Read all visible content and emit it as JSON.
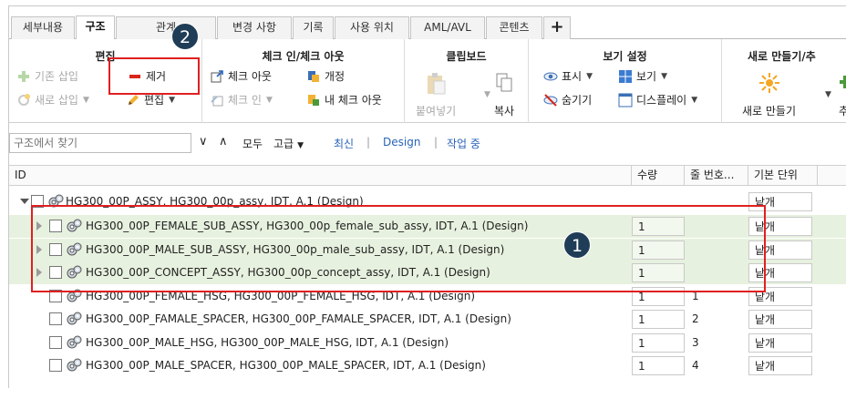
{
  "tabs": [
    {
      "label": "세부내용",
      "active": false
    },
    {
      "label": "구조",
      "active": true
    },
    {
      "label": "관계",
      "active": false
    },
    {
      "label": "변경 사항",
      "active": false
    },
    {
      "label": "기록",
      "active": false
    },
    {
      "label": "사용 위치",
      "active": false
    },
    {
      "label": "AML/AVL",
      "active": false
    },
    {
      "label": "콘텐츠",
      "active": false
    },
    {
      "label": "+",
      "active": false
    }
  ],
  "ribbon": {
    "edit": {
      "title": "편집",
      "insert_existing": "기존 삽입",
      "remove": "제거",
      "insert_new": "새로 삽입",
      "edit": "편집"
    },
    "checkin": {
      "title": "체크 인/체크 아웃",
      "checkout": "체크 아웃",
      "revise": "개정",
      "checkin": "체크 인",
      "my_checkouts": "내 체크 아웃"
    },
    "clipboard": {
      "title": "클립보드",
      "paste": "붙여넣기",
      "copy": "복사"
    },
    "view": {
      "title": "보기 설정",
      "show": "표시",
      "views": "보기",
      "hide": "숨기기",
      "display": "디스플레이"
    },
    "new": {
      "title": "새로 만들기/추",
      "new": "새로 만들기",
      "more": "추"
    }
  },
  "search": {
    "placeholder": "구조에서 찾기",
    "all": "모두",
    "advanced": "고급",
    "latest": "최신",
    "design": "Design",
    "working": "작업 중"
  },
  "table": {
    "columns": {
      "id": "ID",
      "qty": "수량",
      "line": "줄 번호...",
      "unit": "기본 단위"
    },
    "root": {
      "label": "HG300_00P_ASSY, HG300_00p_assy, IDT, A.1 (Design)",
      "unit": "낱개"
    },
    "rows": [
      {
        "label": "HG300_00P_FEMALE_SUB_ASSY, HG300_00p_female_sub_assy, IDT, A.1 (Design)",
        "qty": "1",
        "line": "",
        "unit": "낱개",
        "expandable": true,
        "highlighted": true
      },
      {
        "label": "HG300_00P_MALE_SUB_ASSY, HG300_00p_male_sub_assy, IDT, A.1 (Design)",
        "qty": "1",
        "line": "",
        "unit": "낱개",
        "expandable": true,
        "highlighted": true
      },
      {
        "label": "HG300_00P_CONCEPT_ASSY, HG300_00p_concept_assy, IDT, A.1 (Design)",
        "qty": "1",
        "line": "",
        "unit": "낱개",
        "expandable": true,
        "highlighted": true
      },
      {
        "label": "HG300_00P_FEMALE_HSG, HG300_00P_FEMALE_HSG, IDT, A.1 (Design)",
        "qty": "1",
        "line": "1",
        "unit": "낱개",
        "expandable": false,
        "highlighted": false
      },
      {
        "label": "HG300_00P_FAMALE_SPACER, HG300_00P_FAMALE_SPACER, IDT, A.1 (Design)",
        "qty": "1",
        "line": "2",
        "unit": "낱개",
        "expandable": false,
        "highlighted": false
      },
      {
        "label": "HG300_00P_MALE_HSG, HG300_00P_MALE_HSG, IDT, A.1 (Design)",
        "qty": "1",
        "line": "3",
        "unit": "낱개",
        "expandable": false,
        "highlighted": false
      },
      {
        "label": "HG300_00P_MALE_SPACER, HG300_00P_MALE_SPACER, IDT, A.1 (Design)",
        "qty": "1",
        "line": "4",
        "unit": "낱개",
        "expandable": false,
        "highlighted": false
      }
    ]
  },
  "annotations": {
    "badge1": "1",
    "badge2": "2",
    "color": "#e02020",
    "badge_color": "#1f3d57"
  },
  "colors": {
    "highlight_row": "#e7f1df",
    "link": "#2a63b8"
  }
}
